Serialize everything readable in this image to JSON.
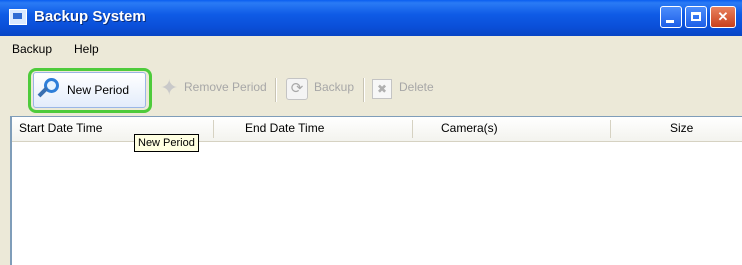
{
  "window": {
    "title": "Backup System",
    "colors": {
      "titlebar": "#0a4fd8",
      "highlight_ring": "#4ecb3b",
      "tooltip_bg": "#ffffe1"
    }
  },
  "menubar": {
    "items": [
      {
        "label": "Backup"
      },
      {
        "label": "Help"
      }
    ]
  },
  "toolbar": {
    "new_period": {
      "label": "New Period",
      "icon": "search-icon",
      "enabled": true
    },
    "remove_period": {
      "label": "Remove Period",
      "icon": "star-icon",
      "enabled": false
    },
    "backup": {
      "label": "Backup",
      "icon": "refresh-icon",
      "enabled": false
    },
    "delete": {
      "label": "Delete",
      "icon": "delete-icon",
      "enabled": false
    }
  },
  "tooltip": {
    "text": "New Period"
  },
  "list": {
    "columns": [
      "Start Date Time",
      "End Date Time",
      "Camera(s)",
      "Size"
    ],
    "rows": []
  }
}
